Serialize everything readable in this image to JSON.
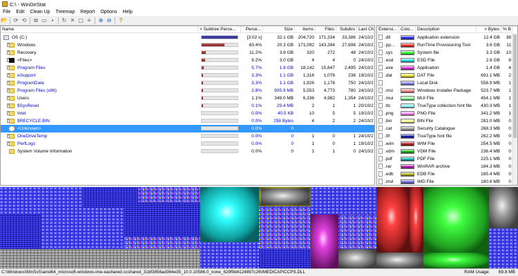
{
  "window": {
    "title": "C:\\ - WinDirStat"
  },
  "menu": [
    "File",
    "Edit",
    "Clean Up",
    "Treemap",
    "Report",
    "Options",
    "Help"
  ],
  "toolbar_icons": [
    "open-icon",
    "refresh-icon",
    "refresh-all-icon",
    "copy-icon",
    "explorer-icon",
    "command-prompt-icon",
    "refresh-selected-icon",
    "delete-icon",
    "delete-recycle-icon",
    "properties-icon",
    "zoom-in-icon",
    "zoom-out-icon",
    "help-icon"
  ],
  "tree": {
    "headers": [
      "Name",
      "> Subtree Perce...",
      "Perce...",
      "Size",
      "Items",
      "Files",
      "Subdirs",
      "Last Ch"
    ],
    "rows": [
      {
        "name": "OS (C:)",
        "pct": "[3:02 s]",
        "perce": "",
        "size": "32.1 GB",
        "items": "204,720",
        "files": "171,334",
        "subdirs": "33,386",
        "last": "24/10/2",
        "bar": 1.0,
        "blue": false,
        "icon": "drive",
        "exp": "",
        "indent": 0
      },
      {
        "name": "Windows",
        "pct": "",
        "perce": "63.4%",
        "size": "20.3 GB",
        "items": "171,092",
        "files": "143,394",
        "subdirs": "27,698",
        "last": "24/10/2",
        "bar": 0.634,
        "blue": false,
        "icon": "folder",
        "exp": "+",
        "indent": 1
      },
      {
        "name": "Recovery",
        "pct": "",
        "perce": "11.2%",
        "size": "3.6 GB",
        "items": "320",
        "files": "272",
        "subdirs": "48",
        "last": "24/10/2",
        "bar": 0.112,
        "blue": false,
        "icon": "folder",
        "exp": "+",
        "indent": 1
      },
      {
        "name": "<Files>",
        "pct": "",
        "perce": "9.2%",
        "size": "3.0 GB",
        "items": "4",
        "files": "4",
        "subdirs": "0",
        "last": "24/10/2",
        "bar": 0.092,
        "blue": false,
        "icon": "files",
        "exp": "+",
        "indent": 1
      },
      {
        "name": "Program Files",
        "pct": "",
        "perce": "5.7%",
        "size": "1.8 GB",
        "items": "18,142",
        "files": "15,647",
        "subdirs": "2,495",
        "last": "24/10/2",
        "bar": 0.057,
        "blue": true,
        "icon": "folder",
        "exp": "+",
        "indent": 1
      },
      {
        "name": "eSupport",
        "pct": "",
        "perce": "3.3%",
        "size": "1.1 GB",
        "items": "1,316",
        "files": "1,078",
        "subdirs": "238",
        "last": "19/10/2",
        "bar": 0.033,
        "blue": true,
        "icon": "folder",
        "exp": "+",
        "indent": 1
      },
      {
        "name": "ProgramData",
        "pct": "",
        "perce": "3.3%",
        "size": "1.1 GB",
        "items": "1,926",
        "files": "1,176",
        "subdirs": "750",
        "last": "24/10/2",
        "bar": 0.033,
        "blue": true,
        "icon": "folder",
        "exp": "+",
        "indent": 1
      },
      {
        "name": "Program Files (x86)",
        "pct": "",
        "perce": "2.8%",
        "size": "905.9 MB",
        "items": "5,553",
        "files": "4,773",
        "subdirs": "780",
        "last": "24/10/2",
        "bar": 0.028,
        "blue": true,
        "icon": "folder",
        "exp": "+",
        "indent": 1
      },
      {
        "name": "Users",
        "pct": "",
        "perce": "1.1%",
        "size": "349.0 MB",
        "items": "6,336",
        "files": "4,982",
        "subdirs": "1,354",
        "last": "24/10/2",
        "bar": 0.011,
        "blue": false,
        "icon": "folder",
        "exp": "+",
        "indent": 1
      },
      {
        "name": "$SysReset",
        "pct": "",
        "perce": "0.1%",
        "size": "29.4 MB",
        "items": "2",
        "files": "1",
        "subdirs": "1",
        "last": "20/10/2",
        "bar": 0.001,
        "blue": true,
        "icon": "folder",
        "exp": "+",
        "indent": 1
      },
      {
        "name": "Intel",
        "pct": "",
        "perce": "0.0%",
        "size": "40.5 KB",
        "items": "10",
        "files": "5",
        "subdirs": "5",
        "last": "19/10/2",
        "bar": 0.0,
        "blue": true,
        "icon": "folder",
        "exp": "+",
        "indent": 1
      },
      {
        "name": "$RECYCLE.BIN",
        "pct": "",
        "perce": "0.0%",
        "size": "258 Bytes",
        "items": "4",
        "files": "2",
        "subdirs": "2",
        "last": "24/10/2",
        "bar": 0.0,
        "blue": true,
        "icon": "folder",
        "exp": "+",
        "indent": 1
      },
      {
        "name": "<Unknown>",
        "pct": "",
        "perce": "0.0%",
        "size": "0",
        "items": "",
        "files": "",
        "subdirs": "",
        "last": "",
        "bar": 0.0,
        "blue": false,
        "icon": "unknown",
        "exp": "",
        "indent": 1,
        "selected": true
      },
      {
        "name": "OneDriveTemp",
        "pct": "",
        "perce": "0.0%",
        "size": "0",
        "items": "1",
        "files": "0",
        "subdirs": "1",
        "last": "24/10/2",
        "bar": 0.0,
        "blue": true,
        "icon": "folder",
        "exp": "+",
        "indent": 1
      },
      {
        "name": "PerfLogs",
        "pct": "",
        "perce": "0.0%",
        "size": "0",
        "items": "1",
        "files": "0",
        "subdirs": "1",
        "last": "19/10/2",
        "bar": 0.0,
        "blue": true,
        "icon": "folder",
        "exp": "+",
        "indent": 1
      },
      {
        "name": "System Volume Information",
        "pct": "",
        "perce": "0.0%",
        "size": "0",
        "items": "1",
        "files": "1",
        "subdirs": "0",
        "last": "24/10/2",
        "bar": 0.0,
        "blue": false,
        "icon": "folder",
        "exp": "",
        "indent": 1
      }
    ]
  },
  "extensions": {
    "headers": [
      "Extensi...",
      "Colo...",
      "Description",
      "> Bytes",
      "% B"
    ],
    "rows": [
      {
        "ext": ".dll",
        "color": "#2b2bff",
        "desc": "Application extension",
        "bytes": "12.4 GB",
        "pct": "38"
      },
      {
        "ext": ".pp...",
        "color": "#ff2b2b",
        "desc": "RunTime Provisioning Tool",
        "bytes": "3.6 GB",
        "pct": "11"
      },
      {
        "ext": ".sys",
        "color": "#2bff2b",
        "desc": "System file",
        "bytes": "3.3 GB",
        "pct": "10"
      },
      {
        "ext": ".esd",
        "color": "#22e0e0",
        "desc": "ESD File",
        "bytes": "2.8 GB",
        "pct": "8"
      },
      {
        "ext": ".exe",
        "color": "#e02be0",
        "desc": "Application",
        "bytes": "1.4 GB",
        "pct": "4"
      },
      {
        "ext": ".dat",
        "color": "#e8e82b",
        "desc": "DAT File",
        "bytes": "691.1 MB",
        "pct": "2"
      },
      {
        "ext": "",
        "color": "#8c8cff",
        "desc": "Local Disk",
        "bytes": "558.9 MB",
        "pct": "1"
      },
      {
        "ext": ".msi",
        "color": "#ff8c8c",
        "desc": "Windows Installer Package",
        "bytes": "523.7 MB",
        "pct": "1"
      },
      {
        "ext": ".mui",
        "color": "#8cff8c",
        "desc": "MUI File",
        "bytes": "454.1 MB",
        "pct": "1"
      },
      {
        "ext": ".ttc",
        "color": "#8cffff",
        "desc": "TrueType collection font file",
        "bytes": "430.3 MB",
        "pct": "1"
      },
      {
        "ext": ".png",
        "color": "#ff8cff",
        "desc": "PNG File",
        "bytes": "341.2 MB",
        "pct": "1"
      },
      {
        "ext": ".bin",
        "color": "#ffff8c",
        "desc": "BIN File",
        "bytes": "281.0 MB",
        "pct": "0"
      },
      {
        "ext": ".cat",
        "color": "#a0a0a0",
        "desc": "Security Catalogue",
        "bytes": "268.3 MB",
        "pct": "0"
      },
      {
        "ext": ".ttf",
        "color": "#1a1ab0",
        "desc": "TrueType font file",
        "bytes": "262.2 MB",
        "pct": "0"
      },
      {
        "ext": ".wim",
        "color": "#b01a1a",
        "desc": "WIM File",
        "bytes": "254.5 MB",
        "pct": "0"
      },
      {
        "ext": ".vdm",
        "color": "#1ab01a",
        "desc": "VDM File",
        "bytes": "236.4 MB",
        "pct": "0"
      },
      {
        "ext": ".pdf",
        "color": "#1ab0b0",
        "desc": "PDF File",
        "bytes": "225.1 MB",
        "pct": "0"
      },
      {
        "ext": ".rar",
        "color": "#b01ab0",
        "desc": "WinRAR archive",
        "bytes": "184.3 MB",
        "pct": "0"
      },
      {
        "ext": ".edb",
        "color": "#b0b01a",
        "desc": "EDB File",
        "bytes": "165.4 MB",
        "pct": "0"
      },
      {
        "ext": ".imd",
        "color": "#6a6ae0",
        "desc": "IMD File",
        "bytes": "160.6 MB",
        "pct": "0"
      }
    ]
  },
  "status": {
    "path": "C:\\Windows\\WinSxS\\amd64_microsoft-windows-ime-eashared-ccshared_31bf3856ad364e35_10.0.10586.0_none_629f9d4124897c26\\IMEDICAPICCPS.DLL",
    "ram_label": "RAM Usage:",
    "ram_value": "69.8 MB"
  }
}
